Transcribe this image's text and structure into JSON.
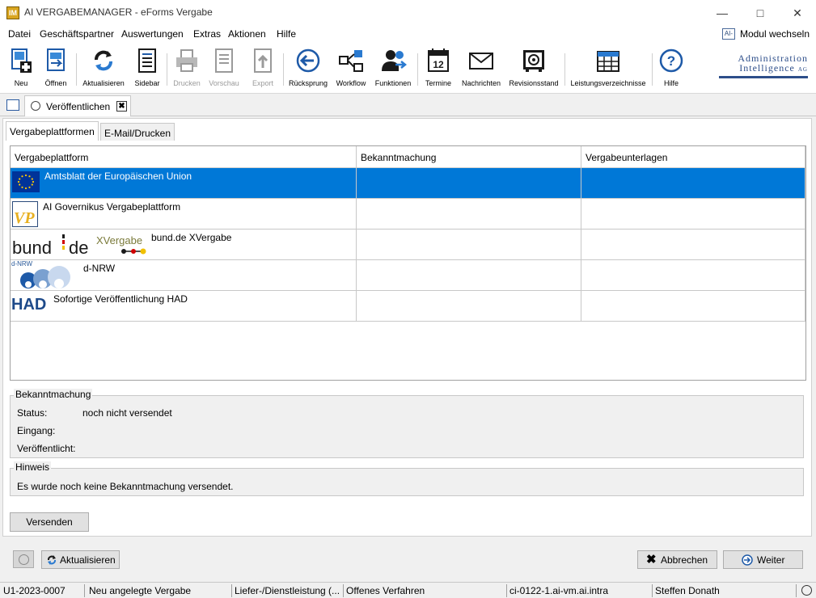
{
  "window": {
    "title": "AI VERGABEMANAGER - eForms Vergabe",
    "app_icon": "IM",
    "minimize_icon": "minimize-icon",
    "maximize_icon": "maximize-icon",
    "close_icon": "close-icon"
  },
  "menu": {
    "items": [
      "Datei",
      "Geschäftspartner",
      "Auswertungen",
      "Extras",
      "Aktionen",
      "Hilfe"
    ],
    "modul_wechseln": "Modul wechseln",
    "modul_icon_text": "AI-"
  },
  "toolbar": {
    "buttons": [
      {
        "label": "Neu",
        "icon": "new-document-icon",
        "enabled": true
      },
      {
        "label": "Öffnen",
        "icon": "open-document-icon",
        "enabled": true
      },
      {
        "label": "Aktualisieren",
        "icon": "refresh-icon",
        "enabled": true
      },
      {
        "label": "Sidebar",
        "icon": "sidebar-icon",
        "enabled": true
      },
      {
        "label": "Drucken",
        "icon": "printer-icon",
        "enabled": false
      },
      {
        "label": "Vorschau",
        "icon": "preview-icon",
        "enabled": false
      },
      {
        "label": "Export",
        "icon": "export-icon",
        "enabled": false
      },
      {
        "label": "Rücksprung",
        "icon": "back-arrow-icon",
        "enabled": true
      },
      {
        "label": "Workflow",
        "icon": "workflow-icon",
        "enabled": true
      },
      {
        "label": "Funktionen",
        "icon": "functions-icon",
        "enabled": true
      },
      {
        "label": "Termine",
        "icon": "calendar-icon",
        "enabled": true
      },
      {
        "label": "Nachrichten",
        "icon": "mail-icon",
        "enabled": true
      },
      {
        "label": "Revisionsstand",
        "icon": "safe-icon",
        "enabled": true
      },
      {
        "label": "Leistungsverzeichnisse",
        "icon": "table-icon",
        "enabled": true
      },
      {
        "label": "Hilfe",
        "icon": "help-icon",
        "enabled": true
      }
    ],
    "brand_line1": "Administration",
    "brand_line2": "Intelligence",
    "brand_suffix": "AG"
  },
  "doc_tab": {
    "label": "Veröffentlichen",
    "icon": "globe-icon",
    "close_glyph": "✖"
  },
  "subtabs": [
    {
      "label": "Vergabeplattformen",
      "active": true
    },
    {
      "label": "E-Mail/Drucken",
      "active": false
    }
  ],
  "grid": {
    "columns": [
      "Vergabeplattform",
      "Bekanntmachung",
      "Vergabeunterlagen"
    ],
    "rows": [
      {
        "name": "Amtsblatt der Europäischen Union",
        "logo": "eu-flag-icon",
        "bekanntmachung": "",
        "vergabeunterlagen": "",
        "selected": true
      },
      {
        "name": "AI Governikus Vergabeplattform",
        "logo": "vp-logo-icon",
        "logo_text": "VP",
        "bekanntmachung": "",
        "vergabeunterlagen": "",
        "selected": false
      },
      {
        "name": "bund.de XVergabe",
        "logo": "bund-de-logo",
        "logo_text_a": "bund",
        "logo_text_b": "de",
        "logo_text_c": "XVergabe",
        "bekanntmachung": "",
        "vergabeunterlagen": "",
        "selected": false
      },
      {
        "name": "d-NRW",
        "logo": "d-nrw-logo",
        "logo_text": "d-NRW",
        "bekanntmachung": "",
        "vergabeunterlagen": "",
        "selected": false
      },
      {
        "name": "Sofortige Veröffentlichung HAD",
        "logo": "had-logo",
        "logo_text": "HAD",
        "bekanntmachung": "",
        "vergabeunterlagen": "",
        "selected": false
      }
    ]
  },
  "bekanntmachung": {
    "title": "Bekanntmachung",
    "status_label": "Status:",
    "status_value": "noch nicht versendet",
    "eingang_label": "Eingang:",
    "eingang_value": "",
    "veroeffentlicht_label": "Veröffentlicht:",
    "veroeffentlicht_value": ""
  },
  "hinweis": {
    "title": "Hinweis",
    "text": "Es wurde noch keine Bekanntmachung versendet."
  },
  "buttons": {
    "versenden": "Versenden",
    "aktualisieren": "Aktualisieren",
    "abbrechen": "Abbrechen",
    "weiter": "Weiter"
  },
  "statusbar": {
    "items": [
      "U1-2023-0007",
      "Neu angelegte Vergabe",
      "Liefer-/Dienstleistung (...",
      "Offenes Verfahren",
      "ci-0122-1.ai-vm.ai.intra",
      "Steffen Donath"
    ]
  },
  "colors": {
    "selection": "#0078d7",
    "brand": "#2d4e8a",
    "eu_blue": "#003399",
    "eu_gold": "#ffcc00"
  }
}
